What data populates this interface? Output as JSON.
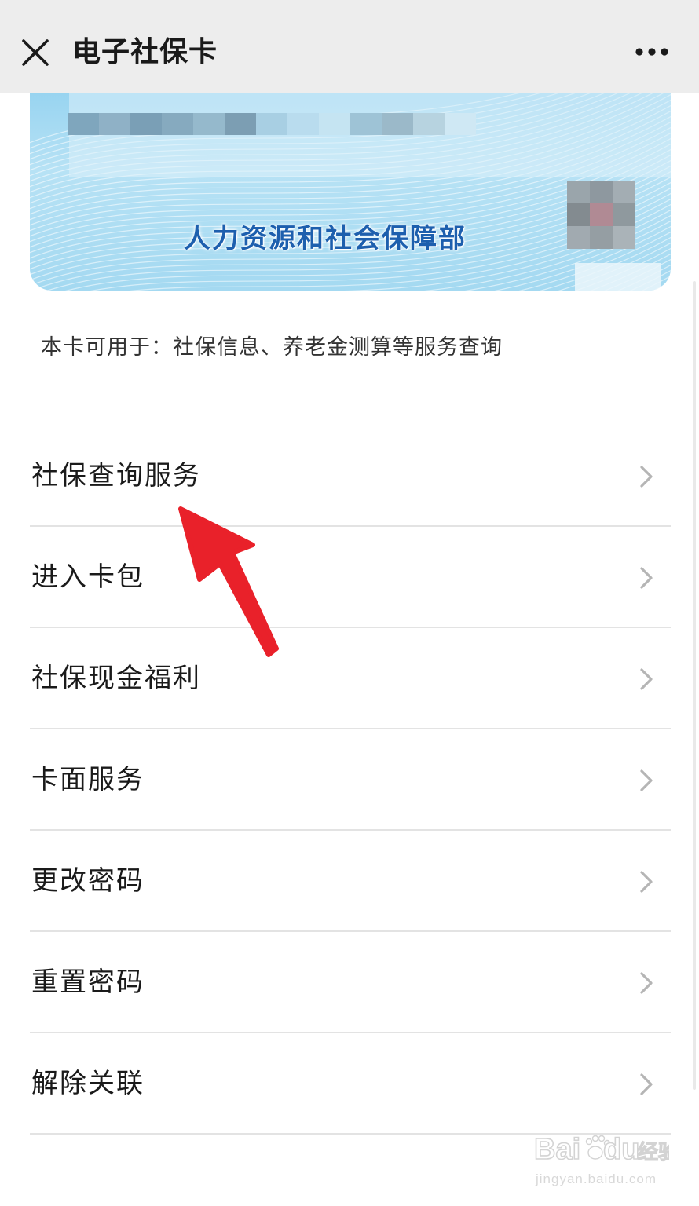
{
  "header": {
    "title": "电子社保卡",
    "close_icon": "close-icon",
    "more_icon": "more-dots-icon"
  },
  "card": {
    "ministry_name": "人力资源和社会保障部",
    "colors": {
      "card_blue": "#a4d9f1",
      "ministry_text": "#1d5fae"
    }
  },
  "usage_note": "本卡可用于：社保信息、养老金测算等服务查询",
  "menu": {
    "items": [
      {
        "label": "社保查询服务"
      },
      {
        "label": "进入卡包"
      },
      {
        "label": "社保现金福利"
      },
      {
        "label": "卡面服务"
      },
      {
        "label": "更改密码"
      },
      {
        "label": "重置密码"
      },
      {
        "label": "解除关联"
      }
    ],
    "chevron_icon": "chevron-right-icon"
  },
  "annotation": {
    "arrow_color": "#e9212a",
    "arrow_icon": "red-arrow-icon"
  },
  "watermark": {
    "brand": "Baidu经验",
    "url": "jingyan.baidu.com"
  }
}
